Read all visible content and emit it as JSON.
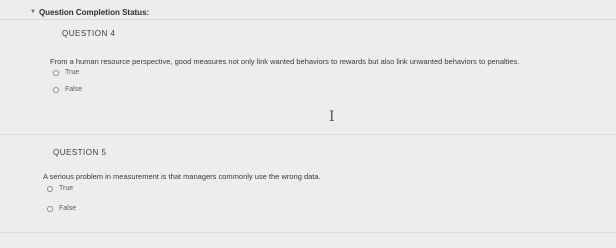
{
  "status": {
    "chevron_icon": "chevron-down-icon",
    "label": "Question Completion Status:"
  },
  "questions": [
    {
      "header": "QUESTION 4",
      "text": "From a human resource perspective, good measures not only link wanted behaviors to rewards but also link unwanted behaviors to penalties.",
      "options": [
        "True",
        "False"
      ]
    },
    {
      "header": "QUESTION 5",
      "text": "A serious problem in measurement is that managers commonly use the wrong data.",
      "options": [
        "True",
        "False"
      ]
    }
  ],
  "cursor": {
    "icon": "text-cursor-icon",
    "glyph": "I"
  }
}
